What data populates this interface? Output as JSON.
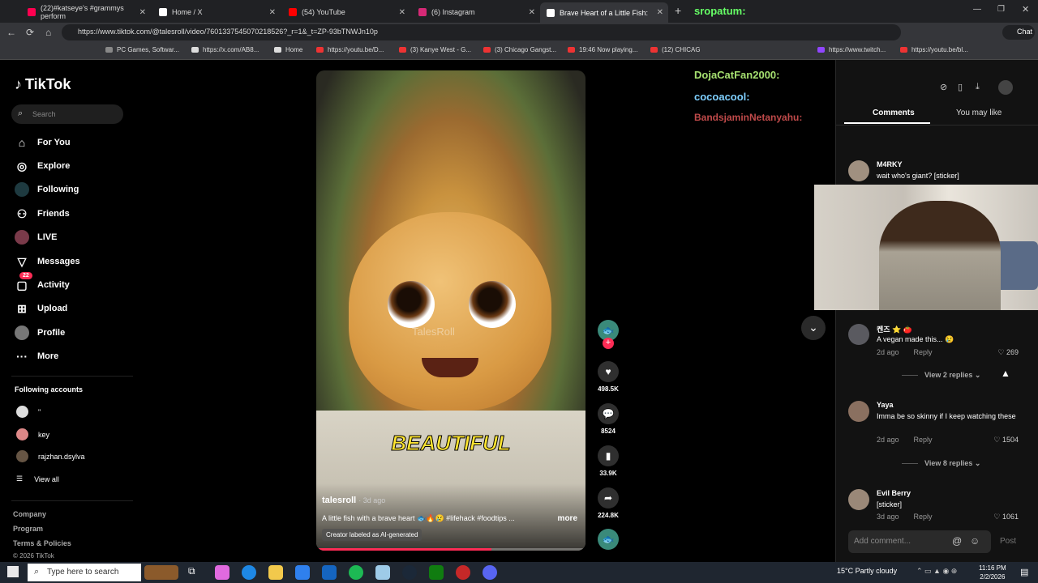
{
  "browser": {
    "tabs": [
      {
        "title": "(22)#katseye's #grammys perform",
        "color": "#ff0050"
      },
      {
        "title": "Home / X",
        "color": "#ffffff"
      },
      {
        "title": "(54) YouTube",
        "color": "#ff0000"
      },
      {
        "title": "(6) Instagram",
        "color": "#d62976"
      },
      {
        "title": "Brave Heart of a Little Fish: Cr",
        "color": "#ffffff"
      }
    ],
    "url": "https://www.tiktok.com/@talesroll/video/7601337545070218526?_r=1&_t=ZP-93bTNWJn10p",
    "chat_button": "Chat",
    "bookmarks": [
      "PC Games, Softwar...",
      "https://x.com/AB8...",
      "Home",
      "https://youtu.be/D...",
      "(3) Kanye West - G...",
      "(3) Chicago Gangst...",
      "19:46 Now playing...",
      "(12) CHICAG",
      "https://www.twitch...",
      "https://youtu.be/bl..."
    ]
  },
  "sidebar": {
    "logo": "TikTok",
    "search_placeholder": "Search",
    "nav": [
      "For You",
      "Explore",
      "Following",
      "Friends",
      "LIVE",
      "Messages",
      "Activity",
      "Upload",
      "Profile",
      "More"
    ],
    "activity_badge": "22",
    "following_header": "Following accounts",
    "accounts": [
      "\"",
      "key",
      "rajzhan.dsylva"
    ],
    "view_all": "View all",
    "footer": [
      "Company",
      "Program",
      "Terms & Policies",
      "© 2026 TikTok"
    ]
  },
  "video": {
    "watermark": "TalesRoll",
    "overlay_word": "BEAUTIFUL",
    "username": "talesroll",
    "posted": "· 3d ago",
    "description": "A little fish with a brave heart 🐟🔥😢 #lifehack #foodtips ...",
    "more": "more",
    "ai_label": "Creator labeled as AI-generated",
    "progress_fraction": 0.65
  },
  "actions": {
    "likes": "498.5K",
    "comments": "8524",
    "saves": "33.9K",
    "shares": "224.8K"
  },
  "chat_overlay": [
    {
      "user": "sropatum:",
      "color": "#66ff66"
    },
    {
      "user": "DojaCatFan2000:",
      "color": "#a6e070"
    },
    {
      "user": "cocoacool:",
      "color": "#7fd0ff"
    },
    {
      "user": "BandsjaminNetanyahu:",
      "color": "#c04a4a"
    }
  ],
  "panel": {
    "tab_comments": "Comments",
    "tab_you_may_like": "You may like",
    "add_comment_placeholder": "Add comment...",
    "post_label": "Post",
    "comments": [
      {
        "name": "M4RKY",
        "text": "wait who's giant? [sticker]",
        "meta": "",
        "likes": ""
      },
      {
        "name": "켄즈 ⭐️ 🍅",
        "text": "A vegan made this... 😢",
        "meta": "2d ago",
        "reply": "Reply",
        "likes": "269",
        "replies": "View 2 replies"
      },
      {
        "name": "Yaya",
        "text": "Imma be so skinny if I keep watching these",
        "meta": "2d ago",
        "reply": "Reply",
        "likes": "1504",
        "replies": "View 8 replies"
      },
      {
        "name": "Evil Berry",
        "text": "[sticker]",
        "meta": "3d ago",
        "reply": "Reply",
        "likes": "1061"
      }
    ]
  },
  "taskbar": {
    "search_placeholder": "Type here to search",
    "weather": "15°C  Partly cloudy",
    "time": "11:16 PM",
    "date": "2/2/2026"
  }
}
